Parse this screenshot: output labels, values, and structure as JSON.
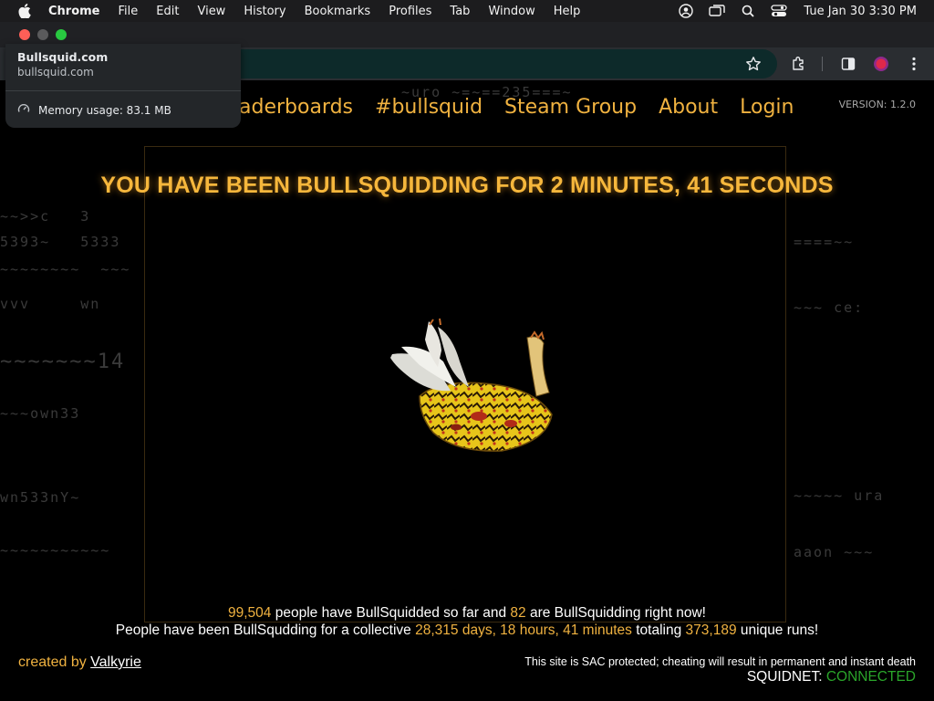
{
  "menubar": {
    "app_name": "Chrome",
    "items": [
      "File",
      "Edit",
      "View",
      "History",
      "Bookmarks",
      "Profiles",
      "Tab",
      "Window",
      "Help"
    ],
    "clock": "Tue Jan 30  3:30 PM",
    "status_icons": [
      "user-icon",
      "screen-mirroring-icon",
      "search-icon",
      "control-center-icon"
    ]
  },
  "browser": {
    "hover_card": {
      "title": "Bullsquid.com",
      "url": "bullsquid.com",
      "memory": "Memory usage: 83.1 MB"
    },
    "toolbar_icons": [
      "bookmark-star-icon",
      "extensions-icon",
      "side-panel-icon",
      "profile-icon",
      "more-menu-icon"
    ]
  },
  "page": {
    "nav": [
      "aderboards",
      "#bullsquid",
      "Steam Group",
      "About",
      "Login"
    ],
    "version": "VERSION: 1.2.0",
    "timer": "YOU HAVE BEEN BULLSQUIDDING FOR 2 MINUTES, 41 SECONDS",
    "stats": {
      "people_count": "99,504",
      "people_text": " people have BullSquidded so far and ",
      "active_count": "82",
      "active_text": " are BullSquidding right now!",
      "line2_prefix": "People have been BullSqudding for a collective ",
      "collective_time": "28,315 days, 18 hours, 41 minutes",
      "line2_mid": " totaling ",
      "runs": "373,189",
      "line2_suffix": " unique runs!"
    },
    "footer": {
      "created_by": "created by ",
      "author": "Valkyrie",
      "sac_notice": "This site is SAC protected; cheating will result in permanent and instant death",
      "squidnet_label": "SQUIDNET: ",
      "squidnet_status": "CONNECTED"
    },
    "colors": {
      "accent": "#f0b240",
      "connected": "#2aa52a"
    }
  }
}
